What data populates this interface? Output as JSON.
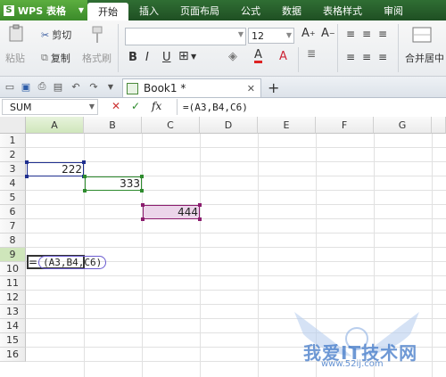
{
  "app": {
    "name": "WPS 表格",
    "logo": "S"
  },
  "menu": [
    "开始",
    "插入",
    "页面布局",
    "公式",
    "数据",
    "表格样式",
    "审阅"
  ],
  "ribbon": {
    "cut": "剪切",
    "paste": "粘贴",
    "copy": "复制",
    "format_painter": "格式刷",
    "font_size": "12",
    "merge": "合并居中"
  },
  "tab": {
    "title": "Book1 *"
  },
  "formula_bar": {
    "name_box": "SUM",
    "formula": "=(A3,B4,C6)"
  },
  "columns": [
    "A",
    "B",
    "C",
    "D",
    "E",
    "F",
    "G"
  ],
  "rows": [
    "1",
    "2",
    "3",
    "4",
    "5",
    "6",
    "7",
    "8",
    "9",
    "10",
    "11",
    "12",
    "13",
    "14",
    "15",
    "16"
  ],
  "cells": {
    "A3": "222",
    "B4": "333",
    "C6": "444"
  },
  "editing": {
    "cell": "A9",
    "prefix": "=",
    "text": "(A3,B4,C6)"
  },
  "watermark": {
    "text": "我爱IT技术网",
    "url": "www.52ij.com"
  },
  "colors": {
    "accent": "#3b8a2a",
    "ref_a3": "#1f2f8f",
    "ref_b4": "#2e8b2e",
    "ref_c6": "#8b1c6e",
    "ref_c6_fill": "#ecd5ea"
  }
}
